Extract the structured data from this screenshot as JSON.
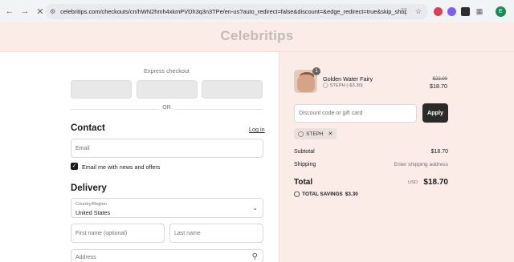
{
  "browser": {
    "url": "celebritips.com/checkouts/cn/hWN2hmh4xkmPVDh3q3n3TPe/en-us?auto_redirect=false&discount=&edge_redirect=true&skip_shop_pay=tr...",
    "profile_initial": "E"
  },
  "header": {
    "logo": "Celebritips"
  },
  "express": {
    "title": "Express checkout",
    "or": "OR"
  },
  "contact": {
    "title": "Contact",
    "login": "Log in",
    "email_placeholder": "Email",
    "newsletter_label": "Email me with news and offers",
    "newsletter_checked": true
  },
  "delivery": {
    "title": "Delivery",
    "country_label": "Country/Region",
    "country_value": "United States",
    "first_name_placeholder": "First name (optional)",
    "last_name_placeholder": "Last name",
    "address_placeholder": "Address"
  },
  "order": {
    "quantity": "1",
    "product_name": "Golden Water Fairy",
    "product_discount": "STEPH (-$3.30)",
    "price_original": "$22.00",
    "price_final": "$18.70",
    "discount_placeholder": "Discount code or gift card",
    "apply_label": "Apply",
    "applied_code": "STEPH",
    "subtotal_label": "Subtotal",
    "subtotal_value": "$18.70",
    "shipping_label": "Shipping",
    "shipping_value": "Enter shipping address",
    "total_label": "Total",
    "total_currency": "USD",
    "total_value": "$18.70",
    "savings_label": "TOTAL SAVINGS",
    "savings_value": "$3.30"
  }
}
